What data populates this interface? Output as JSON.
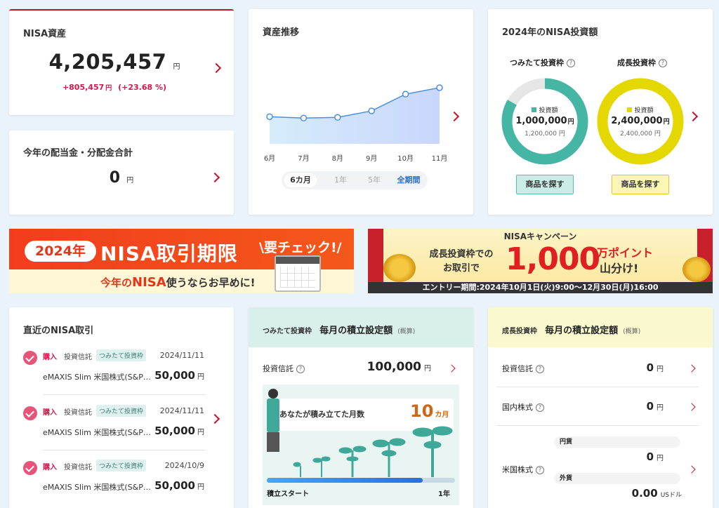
{
  "assets": {
    "title": "NISA資産",
    "value": "4,205,457",
    "unit": "円",
    "gain": "+805,457",
    "gain_unit": "円",
    "gain_pct": "(+23.68 %)"
  },
  "dividend": {
    "title": "今年の配当金・分配金合計",
    "value": "0",
    "unit": "円"
  },
  "trend": {
    "title": "資産推移",
    "months": [
      "6月",
      "7月",
      "8月",
      "9月",
      "10月",
      "11月"
    ],
    "values": [
      3.42,
      3.4,
      3.41,
      3.51,
      3.77,
      3.87
    ],
    "periods": [
      "6カ月",
      "1年",
      "5年",
      "全期間"
    ]
  },
  "invest2024": {
    "title": "2024年のNISA投資額",
    "tsumitate": {
      "label": "つみたて投資枠",
      "legend": "投資額",
      "amount": "1,000,000",
      "unit": "円",
      "limit": "1,200,000 円",
      "fill_ratio": 0.833,
      "button": "商品を探す"
    },
    "growth": {
      "label": "成長投資枠",
      "legend": "投資額",
      "amount": "2,400,000",
      "unit": "円",
      "limit": "2,400,000 円",
      "fill_ratio": 1.0,
      "button": "商品を探す"
    }
  },
  "banner1": {
    "year": "2024年",
    "text": "NISA取引期限",
    "check": "要チェック!",
    "sub_prefix": "今年の",
    "sub_nisa": "NISA",
    "sub_rest": "使うならお早めに!"
  },
  "banner2": {
    "header": "NISAキャンペーン",
    "line1": "成長投資枠での",
    "line2": "お取引で",
    "big": "1,000",
    "unit": "万ポイント",
    "tail": "山分け!",
    "period": "エントリー期間:2024年10月1日(火)9:00～12月30日(月)16:00"
  },
  "recent": {
    "title": "直近のNISA取引",
    "rows": [
      {
        "type": "購入",
        "cat": "投資信託",
        "frame": "つみたて投資枠",
        "date": "2024/11/11",
        "name": "eMAXIS Slim 米国株式(S&P…",
        "amount": "50,000",
        "unit": "円"
      },
      {
        "type": "購入",
        "cat": "投資信託",
        "frame": "つみたて投資枠",
        "date": "2024/11/11",
        "name": "eMAXIS Slim 米国株式(S&P…",
        "amount": "50,000",
        "unit": "円"
      },
      {
        "type": "購入",
        "cat": "投資信託",
        "frame": "つみたて投資枠",
        "date": "2024/10/9",
        "name": "eMAXIS Slim 米国株式(S&P…",
        "amount": "50,000",
        "unit": "円"
      }
    ]
  },
  "monthly_tsumitate": {
    "frame": "つみたて投資枠",
    "title": "毎月の積立設定額",
    "note": "(概算)",
    "fund_label": "投資信託",
    "fund_value": "100,000",
    "fund_unit": "円",
    "months_label": "あなたが積み立てた月数",
    "months_value": "10",
    "months_unit": "カ月",
    "progress": 0.83,
    "start": "積立スタート",
    "end": "1年"
  },
  "monthly_growth": {
    "frame": "成長投資枠",
    "title": "毎月の積立設定額",
    "note": "(概算)",
    "rows": [
      {
        "label": "投資信託",
        "value": "0",
        "unit": "円"
      },
      {
        "label": "国内株式",
        "value": "0",
        "unit": "円"
      }
    ],
    "us": {
      "label": "米国株式",
      "yen_label": "円貨",
      "yen_value": "0",
      "yen_unit": "円",
      "fx_label": "外貨",
      "fx_value": "0.00",
      "fx_unit": "USドル"
    }
  },
  "colors": {
    "accent": "#c0152c",
    "teal": "#45b6a3",
    "yellow": "#e5d700",
    "pink": "#e8537a"
  }
}
